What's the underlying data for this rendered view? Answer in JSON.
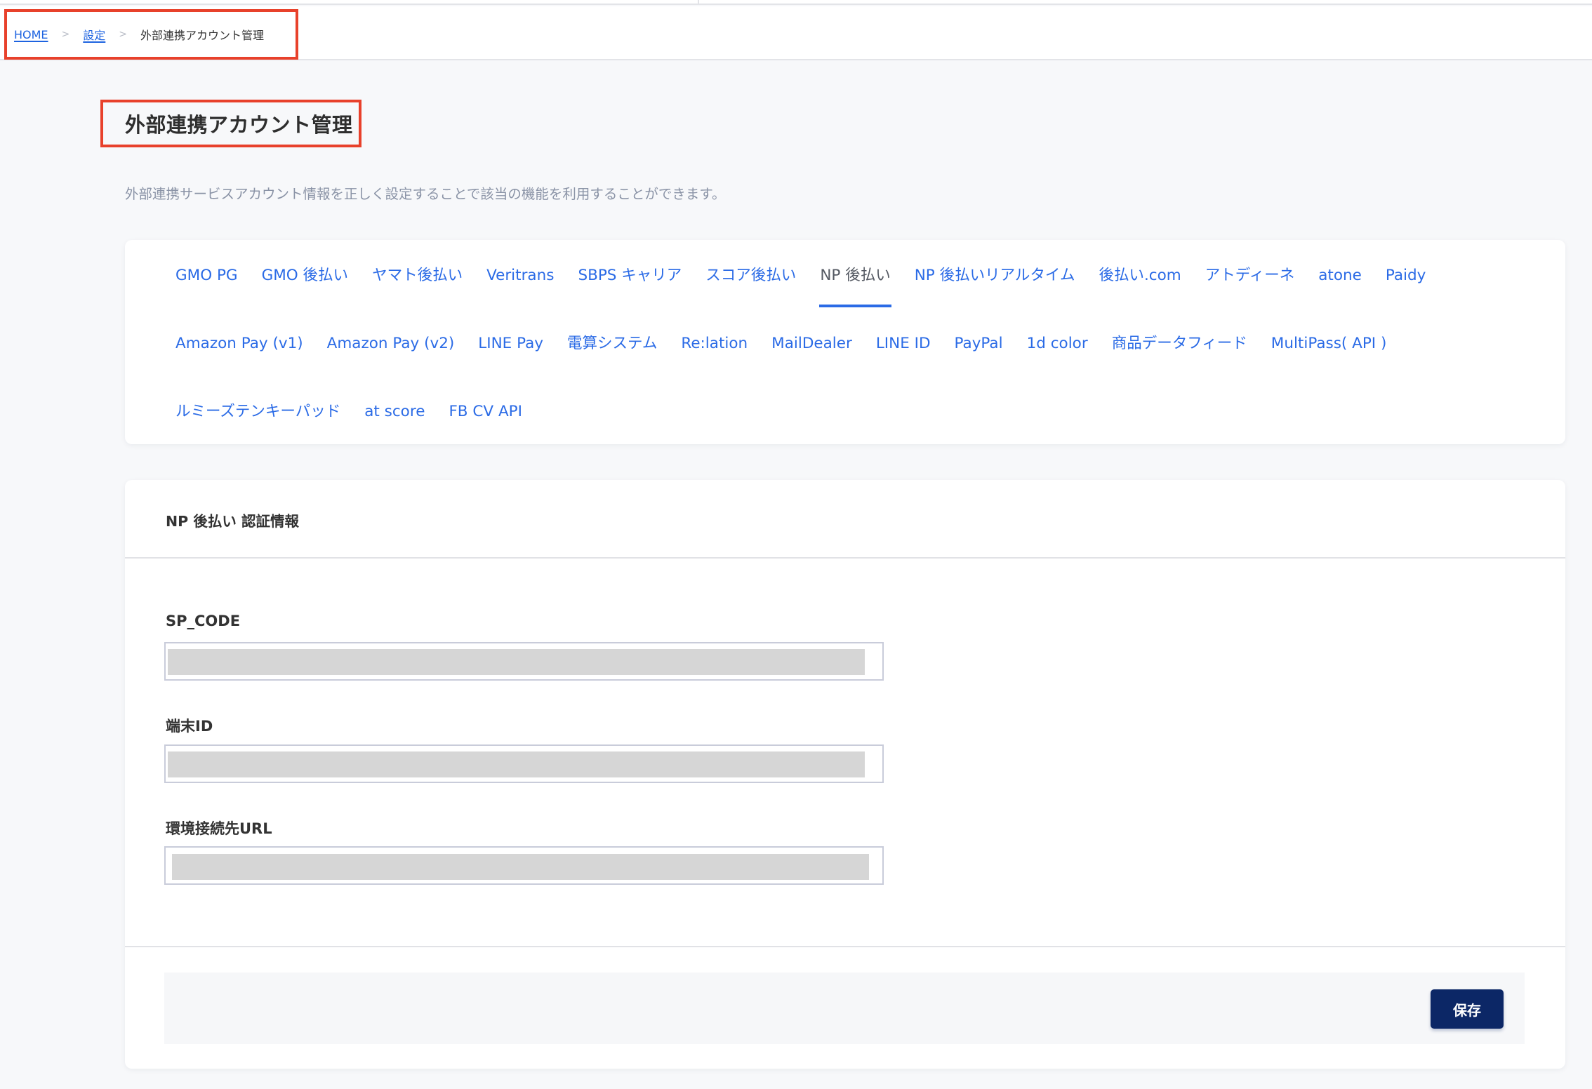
{
  "breadcrumb": {
    "items": [
      {
        "label": "HOME",
        "link": true
      },
      {
        "label": "設定",
        "link": true
      },
      {
        "label": "外部連携アカウント管理",
        "link": false
      }
    ],
    "separator": ">"
  },
  "page": {
    "title": "外部連携アカウント管理",
    "subtitle": "外部連携サービスアカウント情報を正しく設定することで該当の機能を利用することができます。"
  },
  "tabs": {
    "active": "NP 後払い",
    "rows": [
      [
        "GMO PG",
        "GMO 後払い",
        "ヤマト後払い",
        "Veritrans",
        "SBPS キャリア",
        "スコア後払い",
        "NP 後払い",
        "NP 後払いリアルタイム",
        "後払い.com",
        "アトディーネ",
        "atone",
        "Paidy"
      ],
      [
        "Amazon Pay (v1)",
        "Amazon Pay (v2)",
        "LINE Pay",
        "電算システム",
        "Re:lation",
        "MailDealer",
        "LINE ID",
        "PayPal",
        "1d color",
        "商品データフィード",
        "MultiPass( API )"
      ],
      [
        "ルミーズテンキーパッド",
        "at score",
        "FB CV API"
      ]
    ]
  },
  "form": {
    "title": "NP 後払い 認証情報",
    "fields": [
      {
        "label": "SP_CODE",
        "value": "(masked)"
      },
      {
        "label": "端末ID",
        "value": "(masked)"
      },
      {
        "label": "環境接続先URL",
        "value": "(masked)"
      }
    ],
    "save_label": "保存"
  },
  "colors": {
    "link": "#2b6be6",
    "active_tab": "#555a63",
    "highlight_border": "#e8412b",
    "save_button": "#0c2766",
    "masked_fill": "#d6d6d6"
  }
}
